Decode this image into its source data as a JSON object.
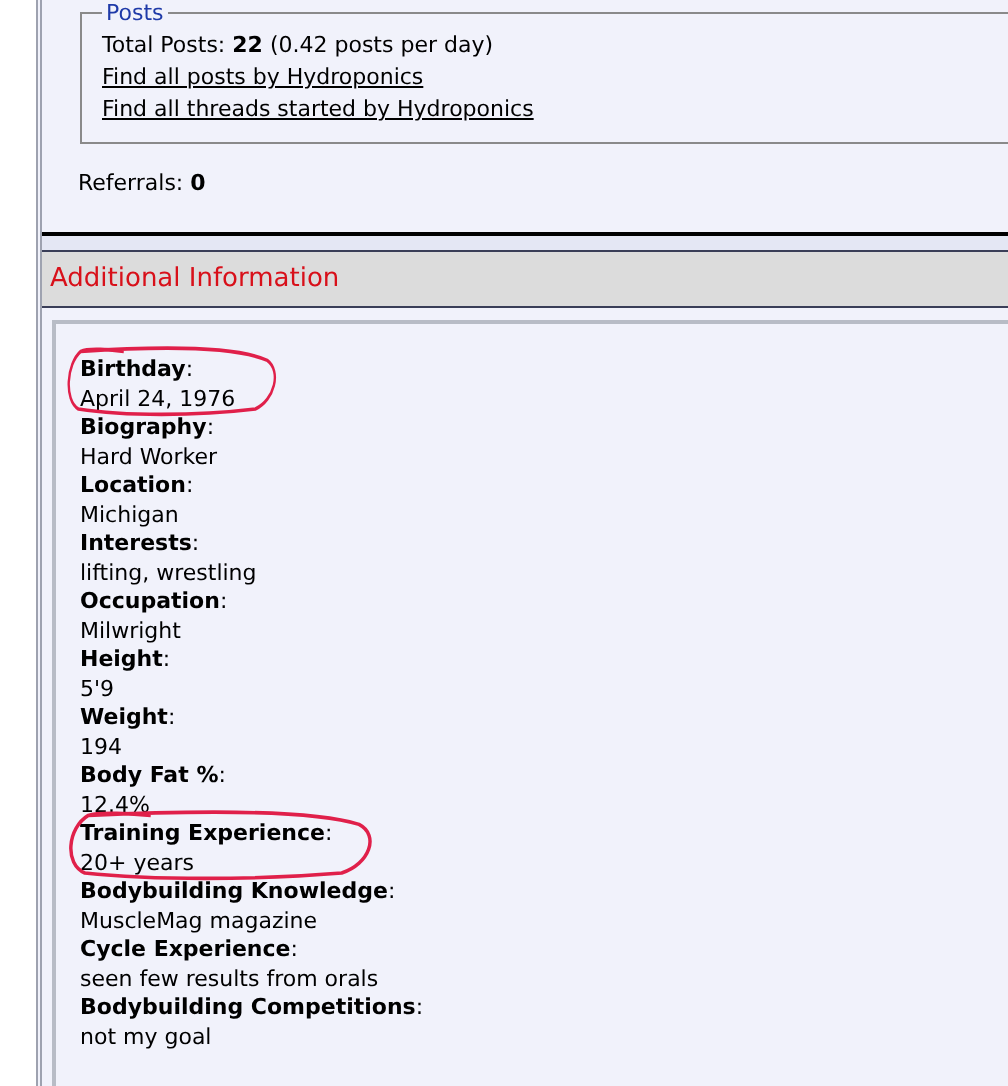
{
  "posts": {
    "legend": "Posts",
    "total_label": "Total Posts:",
    "total_value": "22",
    "total_rate": "(0.42 posts per day)",
    "links": [
      "Find all posts by Hydroponics",
      "Find all threads started by Hydroponics"
    ]
  },
  "referrals": {
    "label": "Referrals:",
    "value": "0"
  },
  "additional": {
    "title": "Additional Information",
    "fields": [
      {
        "label": "**Birthday**:",
        "value": "April 24, 1976",
        "circled": true
      },
      {
        "label": "**Biography**:",
        "value": "Hard Worker",
        "circled": false
      },
      {
        "label": "**Location**:",
        "value": "Michigan",
        "circled": false
      },
      {
        "label": "**Interests**:",
        "value": "lifting, wrestling",
        "circled": false
      },
      {
        "label": "**Occupation**:",
        "value": "Milwright",
        "circled": false
      },
      {
        "label": "**Height**:",
        "value": "5'9",
        "circled": false
      },
      {
        "label": "**Weight**:",
        "value": "194",
        "circled": false
      },
      {
        "label": "**Body Fat %**:",
        "value": "12.4%",
        "circled": false
      },
      {
        "label": "**Training Experience**:",
        "value": "20+ years",
        "circled": true
      },
      {
        "label": "**Bodybuilding Knowledge**:",
        "value": "MuscleMag magazine",
        "circled": false
      },
      {
        "label": "**Cycle Experience**:",
        "value": "seen few results from orals",
        "circled": false
      },
      {
        "label": "**Bodybuilding Competitions**:",
        "value": "not my goal",
        "circled": false
      }
    ]
  }
}
